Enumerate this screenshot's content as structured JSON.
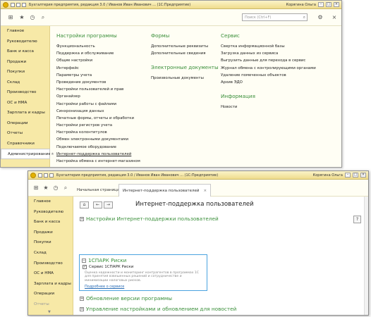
{
  "window1": {
    "title": "Бухгалтерия предприятия, редакция 3.0 / Иванов Иван Иванович ... (1С:Предприятие)",
    "user": "Корягина Ольга",
    "search_placeholder": "Поиск (Ctrl+F)",
    "sidebar": [
      "Главное",
      "Руководителю",
      "Банк и касса",
      "Продажи",
      "Покупки",
      "Склад",
      "Производство",
      "ОС и НМА",
      "Зарплата и кадры",
      "Операции",
      "Отчеты",
      "Справочники",
      "Администрирование"
    ],
    "active_section": "Администрирование",
    "columns": {
      "settings": {
        "heading": "Настройки программы",
        "items": [
          "Функциональность",
          "Поддержка и обслуживание",
          "Общие настройки",
          "Интерфейс",
          "Параметры учета",
          "Проведение документов",
          "Настройки пользователей и прав",
          "Органайзер",
          "Настройки работы с файлами",
          "Синхронизация данных",
          "Печатные формы, отчеты и обработки",
          "Настройки регистров учета",
          "Настройка колонтитулов",
          "Обмен электронными документами",
          "Подключаемое оборудование",
          "Интернет-поддержка пользователей",
          "Настройка обмена с интернет-магазином"
        ]
      },
      "forms": {
        "heading": "Формы",
        "items": [
          "Дополнительные реквизиты",
          "Дополнительные сведения"
        ]
      },
      "edocs": {
        "heading": "Электронные документы",
        "items": [
          "Произвольные документы"
        ]
      },
      "service": {
        "heading": "Сервис",
        "items": [
          "Свертка информационной базы",
          "Загрузка данных из сервиса",
          "Выгрузить данные для перехода в сервис",
          "Журнал обмена с контролирующими органами",
          "Удаление помеченных объектов",
          "Архив ЭДО"
        ]
      },
      "info": {
        "heading": "Информация",
        "items": [
          "Новости"
        ]
      }
    }
  },
  "window2": {
    "title": "Бухгалтерия предприятия, редакция 3.0 / Иванов Иван Иванович ... (1С:Предприятие)",
    "user": "Корягина Ольга",
    "tabs": [
      "Начальная страница",
      "Интернет-поддержка пользователей"
    ],
    "sidebar": [
      "Главное",
      "Руководителю",
      "Банк и касса",
      "Продажи",
      "Покупки",
      "Склад",
      "Производство",
      "ОС и НМА",
      "Зарплата и кадры",
      "Операции",
      "Отчеты"
    ],
    "page_title": "Интернет-поддержка пользователей",
    "help": "?",
    "sections": {
      "settings": "Настройки Интернет-поддержки пользователей",
      "risk": "1СПАРК Риски",
      "update": "Обновление версии программы",
      "manage": "Управление настройками и обновлением для новостей"
    },
    "risk_box": {
      "checkbox_label": "Сервис 1СПАРК Риски",
      "description": "Оценка надежности и мониторинг контрагентов в программах 1С для принятия взвешенных решений и сотрудничестве и минимизации налоговых рисков.",
      "more_link": "Подробнее о сервисе"
    }
  },
  "colors": {
    "sidebar_bg": "#f7e9a7",
    "heading_green": "#3a8f3a",
    "link_blue": "#2a6db5",
    "focus_blue": "#4aa3df"
  }
}
